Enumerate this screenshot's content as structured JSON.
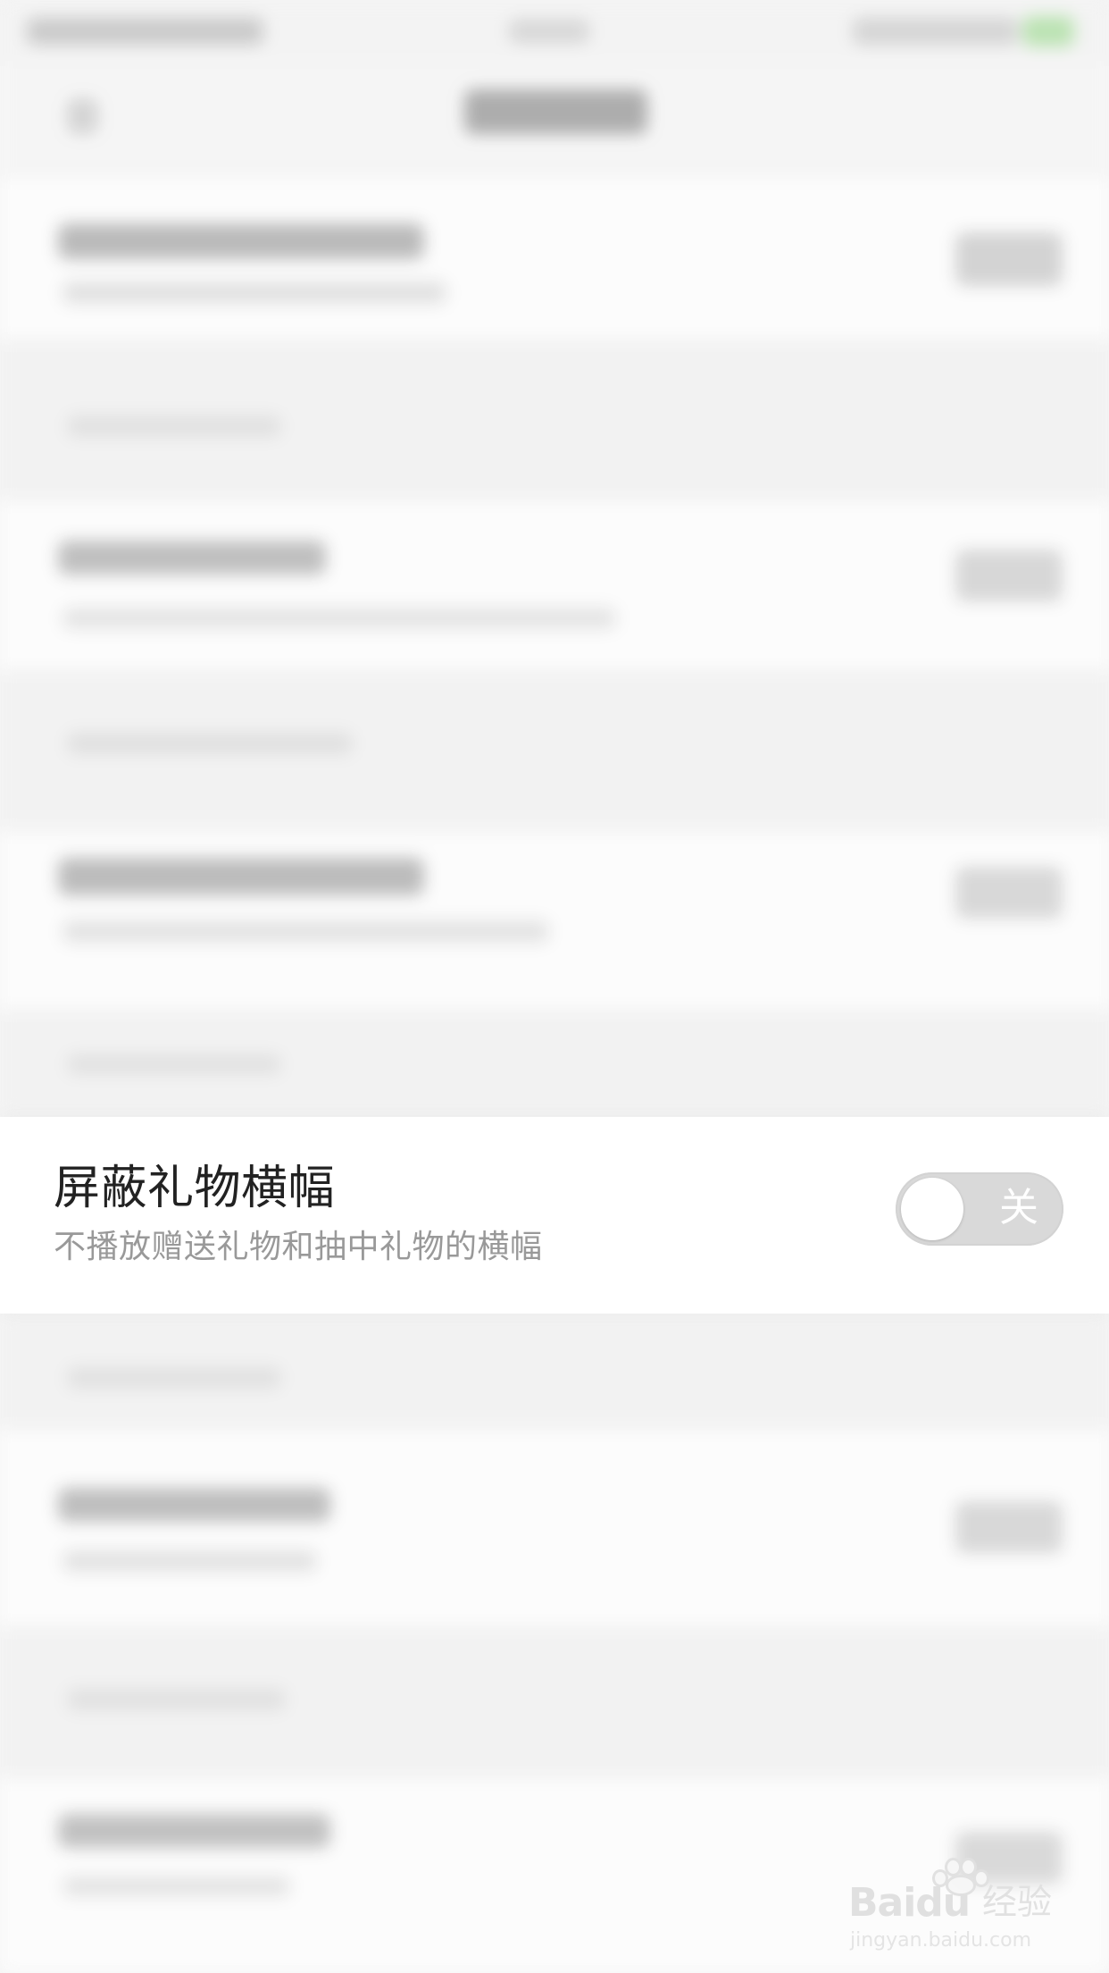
{
  "settings_row": {
    "title": "屏蔽礼物横幅",
    "subtitle": "不播放赠送礼物和抽中礼物的横幅",
    "toggle": {
      "state_label": "关",
      "state": "off"
    }
  },
  "watermark": {
    "brand": "Baidu",
    "suffix": "经验",
    "url": "jingyan.baidu.com"
  },
  "colors": {
    "background": "#f4f4f4",
    "card_background": "#ffffff",
    "title_text": "#222222",
    "subtitle_text": "#999999",
    "toggle_track": "#d9d9d9",
    "toggle_knob": "#ffffff"
  },
  "icons": {
    "back": "chevron-left-icon",
    "watermark_logo": "paw-icon"
  }
}
